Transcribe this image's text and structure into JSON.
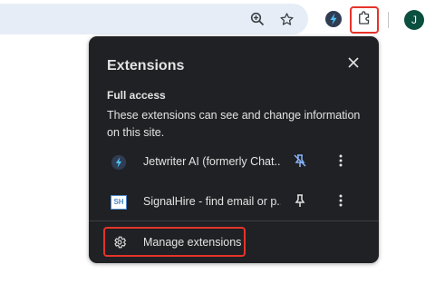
{
  "toolbar": {
    "icons": [
      "zoom-icon",
      "bookmark-star-icon",
      "jetwriter-extension-icon",
      "extensions-puzzle-icon"
    ],
    "avatar_initial": "J"
  },
  "popup": {
    "title": "Extensions",
    "section_heading": "Full access",
    "section_description": "These extensions can see and change information on this site.",
    "extensions": [
      {
        "name": "Jetwriter AI (formerly Chat...",
        "icon": "jetwriter-icon",
        "pinned": true
      },
      {
        "name": "SignalHire - find email or p...",
        "icon": "signalhire-icon",
        "pinned": false,
        "logo_text": "SH"
      }
    ],
    "manage_label": "Manage extensions"
  },
  "colors": {
    "popup_bg": "#1f2124",
    "text": "#e3e3e3",
    "pinned_accent": "#8ab4f8",
    "highlight": "#e5332a",
    "omnibox": "#e6edf7",
    "avatar_bg": "#0b4f3f"
  }
}
